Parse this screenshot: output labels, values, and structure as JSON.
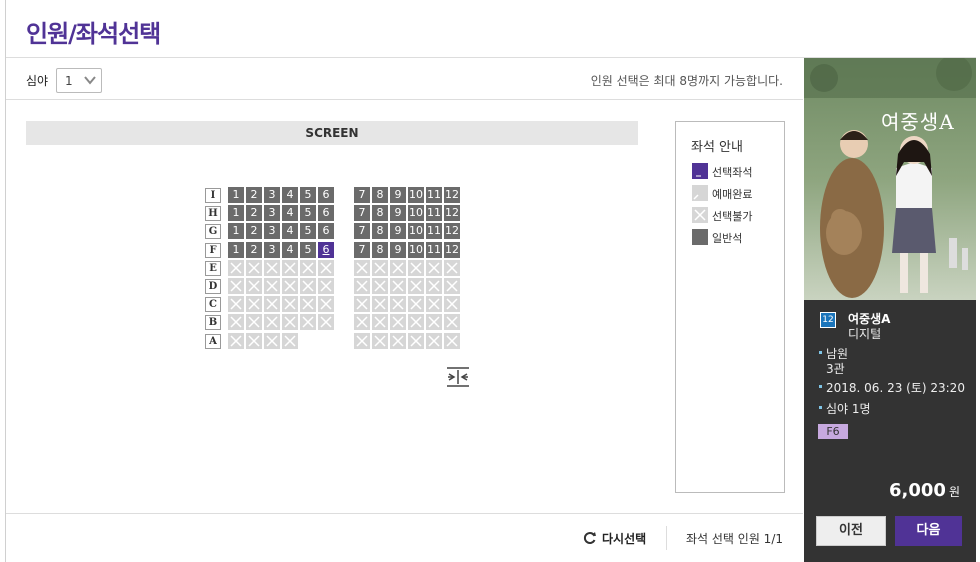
{
  "header": {
    "title": "인원/좌석선택"
  },
  "people": {
    "category_label": "심야",
    "selected_count": "1",
    "note": "인원 선택은 최대 8명까지 가능합니다."
  },
  "screen_label": "SCREEN",
  "seat_rows": [
    {
      "row": "I",
      "left": [
        "1",
        "2",
        "3",
        "4",
        "5",
        "6"
      ],
      "right": [
        "7",
        "8",
        "9",
        "10",
        "11",
        "12"
      ],
      "left_state": "normal",
      "right_state": "normal"
    },
    {
      "row": "H",
      "left": [
        "1",
        "2",
        "3",
        "4",
        "5",
        "6"
      ],
      "right": [
        "7",
        "8",
        "9",
        "10",
        "11",
        "12"
      ],
      "left_state": "normal",
      "right_state": "normal"
    },
    {
      "row": "G",
      "left": [
        "1",
        "2",
        "3",
        "4",
        "5",
        "6"
      ],
      "right": [
        "7",
        "8",
        "9",
        "10",
        "11",
        "12"
      ],
      "left_state": "normal",
      "right_state": "normal"
    },
    {
      "row": "F",
      "left": [
        "1",
        "2",
        "3",
        "4",
        "5",
        "6"
      ],
      "right": [
        "7",
        "8",
        "9",
        "10",
        "11",
        "12"
      ],
      "left_state": "normal",
      "right_state": "normal",
      "selected": "6"
    },
    {
      "row": "E",
      "left_count": 6,
      "right_count": 6,
      "left_state": "unavailable",
      "right_state": "unavailable"
    },
    {
      "row": "D",
      "left_count": 6,
      "right_count": 6,
      "left_state": "unavailable",
      "right_state": "unavailable"
    },
    {
      "row": "C",
      "left_count": 6,
      "right_count": 6,
      "left_state": "unavailable",
      "right_state": "unavailable"
    },
    {
      "row": "B",
      "left_count": 6,
      "right_count": 6,
      "left_state": "unavailable",
      "right_state": "unavailable"
    },
    {
      "row": "A",
      "left_count": 4,
      "right_count": 6,
      "left_state": "unavailable",
      "right_state": "unavailable"
    }
  ],
  "legend": {
    "title": "좌석 안내",
    "items": [
      {
        "label": "선택좌석",
        "kind": "selected",
        "color": "#503396"
      },
      {
        "label": "예매완료",
        "kind": "sold",
        "color": "#d6d6d6"
      },
      {
        "label": "선택불가",
        "kind": "unavailable",
        "color": "#d6d6d6"
      },
      {
        "label": "일반석",
        "kind": "normal",
        "color": "#6b6b6b"
      }
    ]
  },
  "footer": {
    "reset_label": "다시선택",
    "selected_count_text": "좌석 선택 인원 1/1"
  },
  "summary": {
    "poster_title_art": "여중생A",
    "rating": "12",
    "movie_title": "여중생A",
    "format": "디지털",
    "theater": "남원",
    "screen": "3관",
    "datetime": "2018. 06. 23 (토) 23:20",
    "people": "심야 1명",
    "seat": "F6",
    "price": "6,000",
    "price_unit": "원",
    "prev_label": "이전",
    "next_label": "다음"
  },
  "colors": {
    "brand": "#503396",
    "sidebar": "#333333",
    "rating": "#1b75bb"
  }
}
